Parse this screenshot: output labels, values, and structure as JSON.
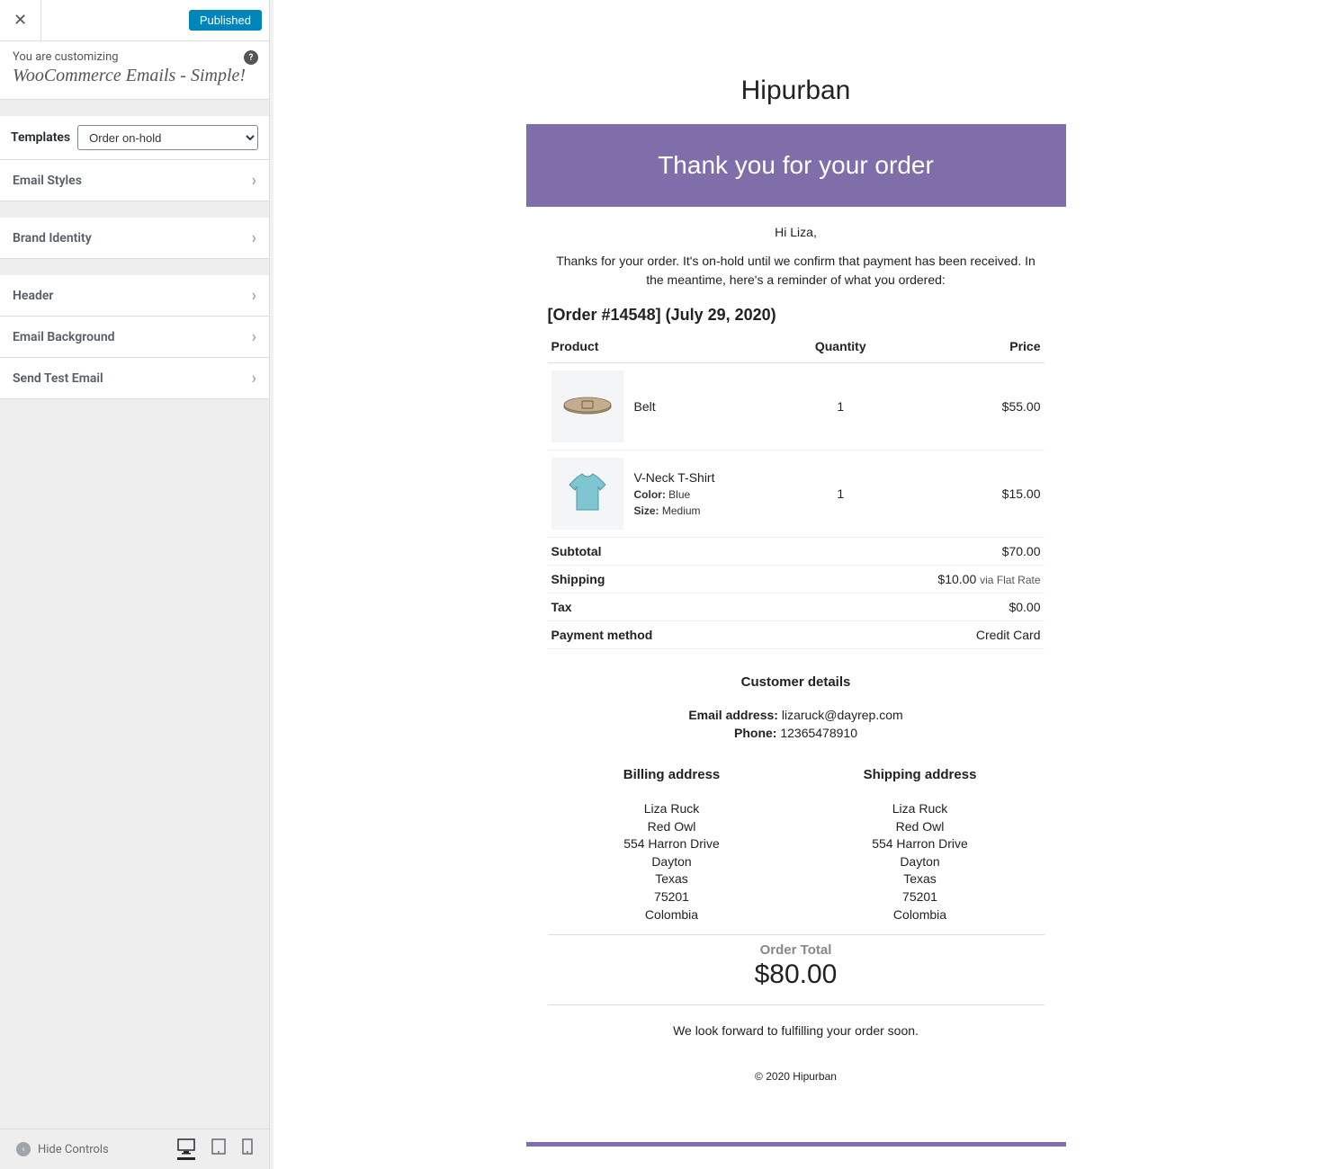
{
  "header": {
    "published_label": "Published"
  },
  "customizing": {
    "label": "You are customizing",
    "title": "WooCommerce Emails - Simple!"
  },
  "templates": {
    "label": "Templates",
    "selected": "Order on-hold"
  },
  "panels": {
    "email_styles": "Email Styles",
    "brand_identity": "Brand Identity",
    "header": "Header",
    "email_background": "Email Background",
    "send_test": "Send Test Email"
  },
  "footer": {
    "hide_controls": "Hide Controls"
  },
  "email": {
    "brand": "Hipurban",
    "heading": "Thank you for your order",
    "greeting": "Hi Liza,",
    "intro": "Thanks for your order. It's on-hold until we confirm that payment has been received. In the meantime, here's a reminder of what you ordered:",
    "order_heading": "[Order #14548] (July 29, 2020)",
    "columns": {
      "product": "Product",
      "quantity": "Quantity",
      "price": "Price"
    },
    "items": [
      {
        "name": "Belt",
        "qty": "1",
        "price": "$55.00"
      },
      {
        "name": "V-Neck T-Shirt",
        "qty": "1",
        "price": "$15.00",
        "color_label": "Color:",
        "color": "Blue",
        "size_label": "Size:",
        "size": "Medium"
      }
    ],
    "totals": {
      "subtotal_label": "Subtotal",
      "subtotal": "$70.00",
      "shipping_label": "Shipping",
      "shipping": "$10.00",
      "shipping_note": "via Flat Rate",
      "tax_label": "Tax",
      "tax": "$0.00",
      "payment_label": "Payment method",
      "payment": "Credit Card"
    },
    "customer": {
      "heading": "Customer details",
      "email_label": "Email address:",
      "email": "lizaruck@dayrep.com",
      "phone_label": "Phone:",
      "phone": "12365478910"
    },
    "billing": {
      "heading": "Billing address",
      "lines": [
        "Liza Ruck",
        "Red Owl",
        "554 Harron Drive",
        "Dayton",
        "Texas",
        "75201",
        "Colombia"
      ]
    },
    "shipping": {
      "heading": "Shipping address",
      "lines": [
        "Liza Ruck",
        "Red Owl",
        "554 Harron Drive",
        "Dayton",
        "Texas",
        "75201",
        "Colombia"
      ]
    },
    "order_total": {
      "label": "Order Total",
      "amount": "$80.00"
    },
    "closing": "We look forward to fulfilling your order soon.",
    "copyright": "© 2020 Hipurban"
  }
}
